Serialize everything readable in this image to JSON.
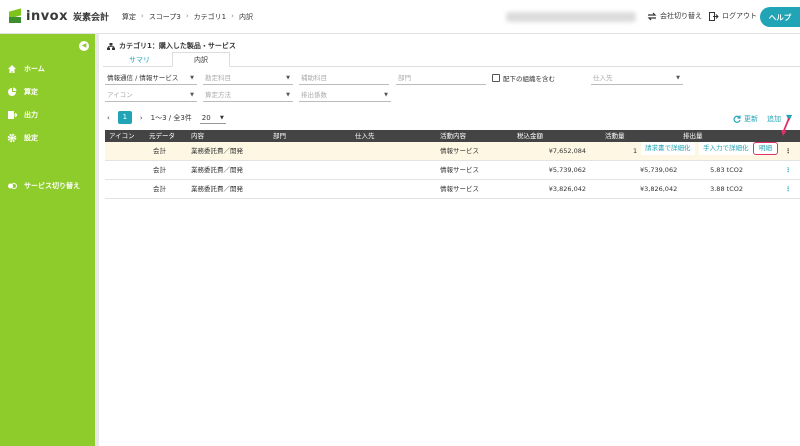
{
  "header": {
    "logo_text": "invox",
    "logo_sub": "炭素会計",
    "breadcrumbs": [
      "算定",
      "スコープ3",
      "カテゴリ1",
      "内訳"
    ],
    "switch_company": "会社切り替え",
    "logout": "ログアウト",
    "help": "ヘルプ"
  },
  "sidebar": {
    "items": [
      {
        "label": "ホーム",
        "icon": "home-icon"
      },
      {
        "label": "算定",
        "icon": "pie-chart-icon"
      },
      {
        "label": "出力",
        "icon": "export-icon"
      },
      {
        "label": "設定",
        "icon": "gear-icon"
      },
      {
        "label": "サービス切り替え",
        "icon": "switch-icon"
      }
    ]
  },
  "page": {
    "title": "カテゴリ1：購入した製品・サービス",
    "tabs": [
      "サマリ",
      "内訳"
    ],
    "active_tab": "内訳"
  },
  "filters": {
    "row1": [
      {
        "value": "情報通信 / 情報サービス",
        "placeholder": ""
      },
      {
        "value": "",
        "placeholder": "勘定科目"
      },
      {
        "value": "",
        "placeholder": "補助科目"
      },
      {
        "value": "",
        "placeholder": "部門"
      },
      {
        "value": "",
        "placeholder": "仕入先"
      }
    ],
    "include_sub_org": "配下の組織を含む",
    "row2": [
      {
        "value": "",
        "placeholder": "アイコン"
      },
      {
        "value": "",
        "placeholder": "算定方法"
      },
      {
        "value": "",
        "placeholder": "排出係数"
      }
    ]
  },
  "pagination": {
    "current_page": "1",
    "range_text": "1〜3 / 全3件",
    "page_size": "20"
  },
  "toolbar": {
    "update": "更新",
    "add": "追加"
  },
  "table": {
    "columns": [
      "アイコン",
      "元データ",
      "内容",
      "部門",
      "仕入先",
      "活動内容",
      "税込金額",
      "活動量",
      "排出量"
    ],
    "rows": [
      {
        "source": "会計",
        "content": "業務委託費／開発",
        "dept": "",
        "supplier": "",
        "activity": "情報サービス",
        "amount": "¥7,652,084",
        "quantity": "",
        "emission": "",
        "highlighted": true
      },
      {
        "source": "会計",
        "content": "業務委託費／開発",
        "dept": "",
        "supplier": "",
        "activity": "情報サービス",
        "amount": "¥5,739,062",
        "quantity": "¥5,739,062",
        "emission": "5.83 tCO2",
        "highlighted": false
      },
      {
        "source": "会計",
        "content": "業務委託費／開発",
        "dept": "",
        "supplier": "",
        "activity": "情報サービス",
        "amount": "¥3,826,042",
        "quantity": "¥3,826,042",
        "emission": "3.88 tCO2",
        "highlighted": false
      }
    ],
    "row_actions": {
      "detail_by_invoice": "請求書で詳細化",
      "detail_manual": "手入力で詳細化",
      "breakdown": "明細"
    },
    "truncated_prefix": "1"
  },
  "colors": {
    "sidebar": "#8dcc2a",
    "accent": "#21a4b6",
    "table_header": "#444444",
    "highlight_row": "#fdf7e3",
    "callout": "#e0306a"
  }
}
